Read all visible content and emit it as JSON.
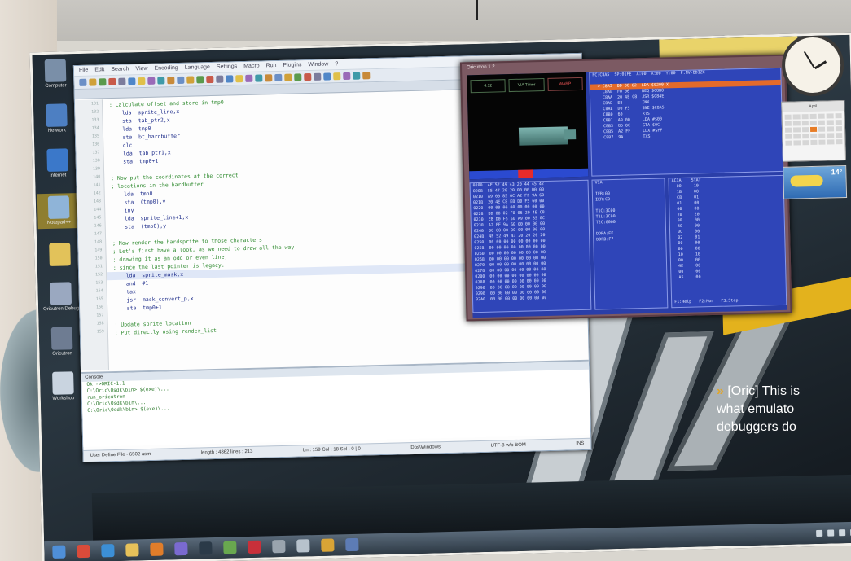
{
  "caption": {
    "marker": "»",
    "lines": [
      "[Oric] This is",
      "what emulato",
      "debuggers do"
    ]
  },
  "desktop": {
    "icons": [
      {
        "name": "computer-icon",
        "label": "Computer",
        "color": "#7a8fa8"
      },
      {
        "name": "network-icon",
        "label": "Network",
        "color": "#4d7fc2"
      },
      {
        "name": "internet-icon",
        "label": "Internet",
        "color": "#3b78c9"
      },
      {
        "name": "program-icon",
        "label": "Notepad++",
        "color": "#8fb4d8"
      },
      {
        "name": "folder-icon",
        "label": "",
        "color": "#e2c25a"
      },
      {
        "name": "archive-icon",
        "label": "Oricutron Debug",
        "color": "#9aa8c0"
      },
      {
        "name": "shortcut-icon",
        "label": "Oricutron",
        "color": "#6e7c92"
      },
      {
        "name": "document-icon",
        "label": "Workshop",
        "color": "#c9d4e0"
      }
    ]
  },
  "editor": {
    "menu": [
      "File",
      "Edit",
      "Search",
      "View",
      "Encoding",
      "Language",
      "Settings",
      "Macro",
      "Run",
      "Plugins",
      "Window",
      "?"
    ],
    "code_lines": [
      {
        "text": "  ; Calculate offset and store in tmp0",
        "kind": "cm"
      },
      {
        "text": "      lda  sprite_line,x",
        "kind": "code"
      },
      {
        "text": "      sta  tab_ptr2,x",
        "kind": "code"
      },
      {
        "text": "      lda  tmp0",
        "kind": "code"
      },
      {
        "text": "      sta  bt_hardbuffer",
        "kind": "code"
      },
      {
        "text": "      clc",
        "kind": "code"
      },
      {
        "text": "      lda  tab_ptr1,x",
        "kind": "code"
      },
      {
        "text": "      sta  tmp0+1",
        "kind": "code"
      },
      {
        "text": "",
        "kind": "code"
      },
      {
        "text": "  ; Now put the coordinates at the correct",
        "kind": "cm"
      },
      {
        "text": "  ; locations in the hardbuffer",
        "kind": "cm"
      },
      {
        "text": "      lda  tmp0",
        "kind": "code"
      },
      {
        "text": "      sta  (tmp0),y",
        "kind": "code"
      },
      {
        "text": "      iny",
        "kind": "code"
      },
      {
        "text": "      lda  sprite_line+1,x",
        "kind": "code"
      },
      {
        "text": "      sta  (tmp0),y",
        "kind": "code"
      },
      {
        "text": "",
        "kind": "code"
      },
      {
        "text": "  ; Now render the hardsprite to those characters",
        "kind": "cm"
      },
      {
        "text": "  ; Let's first have a look, as we need to draw all the way",
        "kind": "cm"
      },
      {
        "text": "  ; drawing it as an odd or even line,",
        "kind": "cm"
      },
      {
        "text": "  ; since the last pointer is legacy.",
        "kind": "cm"
      },
      {
        "text": "      lda  sprite_mask,x",
        "kind": "hl"
      },
      {
        "text": "      and  #1",
        "kind": "code"
      },
      {
        "text": "      tax",
        "kind": "code"
      },
      {
        "text": "      jsr  mask_convert_p,x",
        "kind": "code"
      },
      {
        "text": "      sta  tmp0+1",
        "kind": "code"
      },
      {
        "text": "",
        "kind": "code"
      },
      {
        "text": "  ; Update sprite location",
        "kind": "cm"
      },
      {
        "text": "  ; Put directly using render_list",
        "kind": "cm"
      }
    ],
    "output_title": "Console",
    "output_lines": [
      "Ok ->ORIC-1.1",
      "C:\\Oric\\Osdk\\bin> $(exe)\\...",
      "run_oricutron",
      "C:\\Oric\\Osdk\\bin\\...",
      "C:\\Oric\\Osdk\\bin> $(exe)\\..."
    ],
    "status": {
      "left": "User Define File - 6502 asm",
      "length": "length : 4862    lines : 213",
      "position": "Ln : 159    Col : 18    Sel : 0 | 0",
      "eol": "Dos\\Windows",
      "encoding": "UTF-8 w/o BOM",
      "mode": "INS"
    }
  },
  "emulator": {
    "title": "Oricutron 1.2",
    "readouts": [
      "4.12",
      "VIA Timer",
      "WARP"
    ],
    "panel_top_lines": [
      "PC:C8A5  SP:01FE  A:00  X:00  Y:00  P:NV-BDIZC",
      "",
      "  > C8A5  BD 00 02  LDA $0200,X",
      "    C8A8  F0 06     BEQ $C8B0",
      "    C8AA  20 4E C8  JSR $C84E",
      "    C8AD  E8        INX",
      "    C8AE  D0 F5     BNE $C8A5",
      "    C8B0  60        RTS",
      "    C8B1  A9 00     LDA #$00",
      "    C8B3  85 0C     STA $0C",
      "    C8B5  A2 FF     LDX #$FF",
      "    C8B7  9A        TXS"
    ],
    "mem_lines": [
      "0200  4F 52 49 43 20 44 45 42",
      "0208  55 47 20 20 00 00 00 00",
      "0210  A9 00 85 0C A2 FF 9A 60",
      "0218  20 4E C8 E8 D0 F5 60 00",
      "0220  00 00 00 00 00 00 00 00",
      "0228  BD 00 02 F0 06 20 4E C8",
      "0230  E8 D0 F5 60 A9 00 85 0C",
      "0238  A2 FF 9A 60 00 00 00 00",
      "0240  00 00 00 00 00 00 00 00",
      "0248  4F 52 49 43 20 20 20 20",
      "0250  00 00 00 00 00 00 00 00",
      "0258  00 00 00 00 00 00 00 00",
      "0260  00 00 00 00 00 00 00 00",
      "0268  00 00 00 00 00 00 00 00",
      "0270  00 00 00 00 00 00 00 00",
      "0278  00 00 00 00 00 00 00 00",
      "0280  00 00 00 00 00 00 00 00",
      "0288  00 00 00 00 00 00 00 00",
      "0290  00 00 00 00 00 00 00 00",
      "0298  00 00 00 00 00 00 00 00",
      "02A0  00 00 00 00 00 00 00 00"
    ],
    "via_lines": [
      "VIA",
      "",
      "IFR:00",
      "IER:C0",
      "",
      "T1C:3C00",
      "T1L:3C00",
      "T2C:0000",
      "",
      "DDRA:FF",
      "DDRB:F7"
    ],
    "reg_lines": [
      "ACIA    STAT",
      "  00     10",
      "  1B     00",
      "  C8     01",
      "  01     00",
      "  00     00",
      "  20     20",
      "  00     00",
      "  40     00",
      "  0C     00",
      "  02     01",
      "  00     00",
      "  00     00",
      "  10     10",
      "  00     00",
      "  4E     00",
      "  00     00",
      "  A5     00"
    ],
    "footer": "F1:Help   F2:Mon   F3:Step"
  },
  "gadgets": {
    "calendar_month": "April",
    "temperature": "14°"
  },
  "taskbar": {
    "items": [
      {
        "name": "start-button-icon",
        "color": "#4f8fd8"
      },
      {
        "name": "chrome-icon",
        "color": "#d94b3a"
      },
      {
        "name": "browser-icon",
        "color": "#3c8fd6"
      },
      {
        "name": "folder-icon",
        "color": "#e6c15a"
      },
      {
        "name": "media-icon",
        "color": "#e07d2a"
      },
      {
        "name": "app-icon",
        "color": "#7a6ad0"
      },
      {
        "name": "terminal-icon",
        "color": "#2b3a48"
      },
      {
        "name": "editor-icon",
        "color": "#69a84f"
      },
      {
        "name": "emulator-icon",
        "color": "#c8303a"
      },
      {
        "name": "settings-icon",
        "color": "#9aa4ae"
      },
      {
        "name": "network-icon",
        "color": "#b7c2cc"
      },
      {
        "name": "paint-icon",
        "color": "#d9a436"
      },
      {
        "name": "debugger-icon",
        "color": "#5d7cb5"
      }
    ]
  }
}
